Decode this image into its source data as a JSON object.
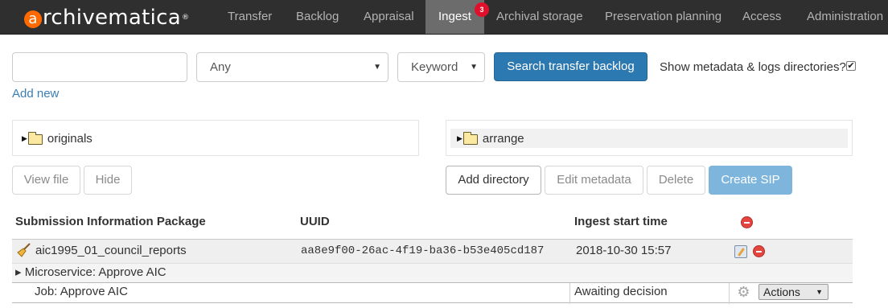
{
  "brand": {
    "name_rest": "rchivematica",
    "logo_letter": "a",
    "tm": "®"
  },
  "nav": {
    "items": [
      "Transfer",
      "Backlog",
      "Appraisal",
      "Ingest",
      "Archival storage",
      "Preservation planning",
      "Access",
      "Administration"
    ],
    "active": "Ingest",
    "ingest_badge": "3"
  },
  "search": {
    "query_value": "",
    "field_selected": "Any",
    "type_selected": "Keyword",
    "search_button": "Search transfer backlog",
    "show_metadata_label": "Show metadata & logs directories?",
    "show_metadata_checked": true,
    "add_new": "Add new"
  },
  "backlog_tree": {
    "folder": "originals"
  },
  "arrange_tree": {
    "folder": "arrange"
  },
  "backlog_buttons": {
    "view_file": "View file",
    "hide": "Hide"
  },
  "arrange_buttons": {
    "add_directory": "Add directory",
    "edit_metadata": "Edit metadata",
    "delete": "Delete",
    "create_sip": "Create SIP"
  },
  "table": {
    "headers": {
      "sip": "Submission Information Package",
      "uuid": "UUID",
      "start_time": "Ingest start time"
    },
    "sip": {
      "name": "aic1995_01_council_reports",
      "uuid": "aa8e9f00-26ac-4f19-ba36-b53e405cd187",
      "start_time": "2018-10-30 15:57"
    },
    "microservice": "▸ Microservice: Approve AIC",
    "job": {
      "name": "Job: Approve AIC",
      "status": "Awaiting decision",
      "actions_label": "Actions"
    }
  },
  "colors": {
    "navbar": "#2f2f2f",
    "active_tab": "#6c6c6c",
    "primary_button": "#2c78b1",
    "create_sip_button": "#7eb5dd",
    "remove_icon": "#e3453f",
    "brand_orange": "#ff6a00"
  }
}
